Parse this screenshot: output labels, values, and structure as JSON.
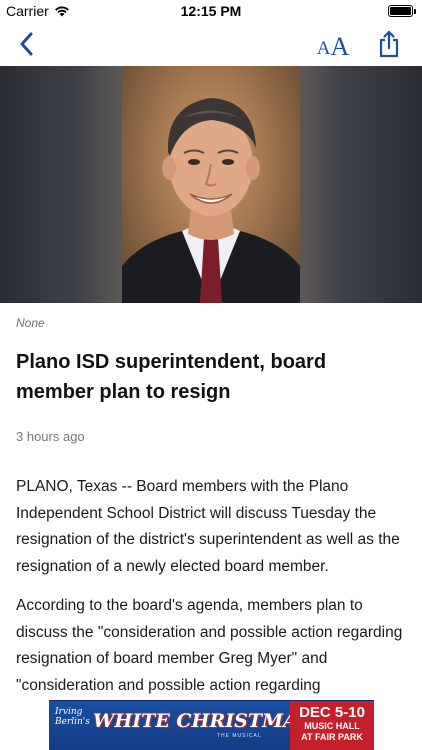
{
  "status_bar": {
    "carrier": "Carrier",
    "time": "12:15 PM",
    "icons": [
      "wifi-icon",
      "battery-icon"
    ]
  },
  "nav_bar": {
    "back_icon": "chevron-left-icon",
    "font_size_label_small": "A",
    "font_size_label_large": "A",
    "share_icon": "share-icon",
    "accent_color": "#1f4e9c"
  },
  "article": {
    "image_caption": "None",
    "headline": "Plano ISD superintendent, board member plan to resign",
    "timestamp": "3 hours ago",
    "paragraphs": [
      "PLANO, Texas -- Board members with the Plano Independent School District will discuss Tuesday the resignation of the district's superintendent as well as the resignation of a newly elected board member.",
      "According to the board's agenda, members plan to discuss the \"consideration and possible action regarding resignation of board member Greg Myer\" and \"consideration and possible action regarding"
    ]
  },
  "ad": {
    "script_text": "Irving Berlin's",
    "title": "WHITE CHRISTMAS",
    "subtitle": "THE MUSICAL",
    "date": "DEC 5-10",
    "venue_line1": "MUSIC HALL",
    "venue_line2": "AT FAIR PARK"
  }
}
